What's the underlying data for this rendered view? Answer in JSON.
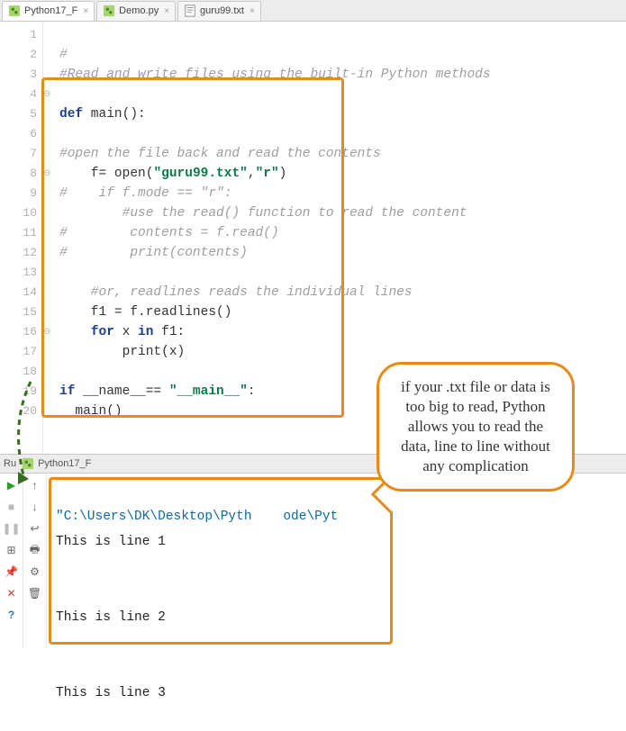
{
  "tabs": [
    {
      "label": "Python17_F",
      "icon": "python-file-icon",
      "active": true
    },
    {
      "label": "Demo.py",
      "icon": "python-file-icon",
      "active": false
    },
    {
      "label": "guru99.txt",
      "icon": "text-file-icon",
      "active": false
    }
  ],
  "gutter_lines": [
    "1",
    "2",
    "3",
    "4",
    "5",
    "6",
    "7",
    "8",
    "9",
    "10",
    "11",
    "12",
    "13",
    "14",
    "15",
    "16",
    "17",
    "18",
    "19",
    "20"
  ],
  "code": {
    "l1_comment_hash": "#",
    "l2_comment": "#Read and write files using the built-in Python methods",
    "l4_def": "def",
    "l4_name": " main():",
    "l6_comment": "#open the file back and read the contents",
    "l7_pre": "    f= ",
    "l7_open": "open",
    "l7_paren_o": "(",
    "l7_str1": "\"guru99.txt\"",
    "l7_comma": ",",
    "l7_str2": "\"r\"",
    "l7_paren_c": ")",
    "l8_comment": "#    if f.mode == \"r\":",
    "l9_comment": "        #use the read() function to read the content",
    "l10_comment": "#        contents = f.read()",
    "l11_comment": "#        print(contents)",
    "l13_comment": "    #or, readlines reads the individual lines",
    "l14_text": "    f1 = f.readlines()",
    "l15_for": "for",
    "l15_mid": " x ",
    "l15_in": "in",
    "l15_end": " f1:",
    "l16_text": "        print(x)",
    "l18_if": "if",
    "l18_mid": " __name__== ",
    "l18_str": "\"__main__\"",
    "l18_colon": ":",
    "l19_text": "  main()"
  },
  "callout_text": "if your .txt file or data is too big to read, Python allows you to read the data, line to line without any complication",
  "run": {
    "label_prefix": "Ru",
    "config_name": "Python17_F",
    "path": "\"C:\\Users\\DK\\Desktop\\Pyth    ode\\Pyt",
    "out1": "This is line 1",
    "out2": "This is line 2",
    "out3": "This is line 3"
  },
  "toolbar": {
    "run": "▶",
    "stop": "■",
    "pause": "❚❚",
    "layout": "⊞",
    "pin": "📌",
    "close": "✕",
    "help": "?",
    "up": "↑",
    "down": "↓",
    "wrap": "↩",
    "print": "🖶",
    "filter": "⚙",
    "trash": "🗑"
  }
}
